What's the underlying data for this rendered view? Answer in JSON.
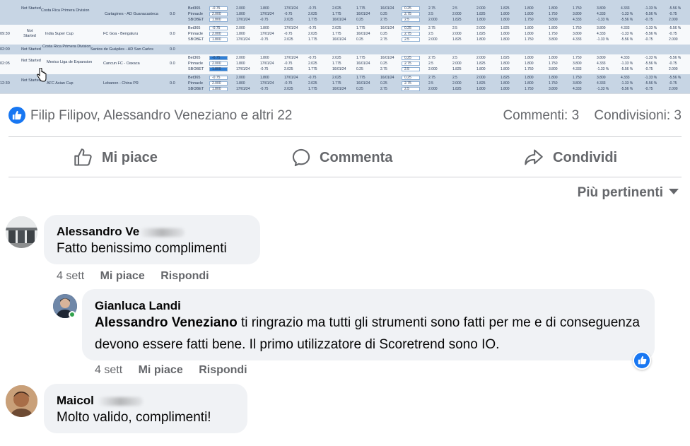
{
  "sheet": {
    "rows": [
      {
        "time": "",
        "status": "Not Started",
        "league": "Costa Rica Primera Division",
        "match": "Cartagines - AD Guanacasteca",
        "score": "0.0",
        "books": [
          "Bet365",
          "Pinnacle",
          "SBOBET"
        ]
      },
      {
        "time": "09:30",
        "status": "Not Started",
        "league": "India Super Cup",
        "match": "FC Goa - Bengaluru",
        "score": "0.0",
        "books": [
          "Bet365",
          "Pinnacle",
          "SBOBET"
        ]
      },
      {
        "time": "02:00",
        "status": "Not Started",
        "league": "Costa Rica Primera Division",
        "match": "Santos de Guápiles - AD San Carlos",
        "score": "0.0",
        "books": []
      },
      {
        "time": "02:05",
        "status": "Not Started",
        "league": "Mexico Liga de Expansion",
        "match": "Cancun FC - Oaxaca",
        "score": "0.0",
        "books": [
          "Bet365",
          "Pinnacle",
          "SBOBET"
        ]
      },
      {
        "time": "12:30",
        "status": "Not Started",
        "league": "AFC Asian Cup",
        "match": "Lebanon - China PR",
        "score": "0.0",
        "books": [
          "Bet365",
          "Pinnacle",
          "SBOBET"
        ]
      }
    ],
    "cells": [
      "-0.75",
      "2.000",
      "1.800",
      "17/01/24",
      "-0.75",
      "2.025",
      "1.775",
      "16/01/24",
      "0.25",
      "2.75",
      "2.5",
      "2.000",
      "1.825",
      "1.800",
      "1.800",
      "1.750",
      "3.800",
      "4.333",
      "-1.33 %",
      "-5.56 %"
    ]
  },
  "reactions": {
    "names": "Filip Filipov, Alessandro Veneziano e altri 22",
    "comments": "Commenti: 3",
    "shares": "Condivisioni: 3"
  },
  "actions": {
    "like": "Mi piace",
    "comment": "Commenta",
    "share": "Condividi"
  },
  "sort": {
    "label": "Più pertinenti"
  },
  "comments": [
    {
      "author": "Alessandro Ve",
      "text": "Fatto benissimo complimenti",
      "time": "4 sett",
      "like": "Mi piace",
      "reply": "Rispondi"
    },
    {
      "author": "Gianluca Landi",
      "mention": "Alessandro Veneziano",
      "text": " ti ringrazio ma tutti gli strumenti sono fatti per me e di conseguenza devono essere fatti bene. Il primo utilizzatore di Scoretrend sono IO.",
      "time": "4 sett",
      "like": "Mi piace",
      "reply": "Rispondi"
    },
    {
      "author": "Maicol",
      "text": "Molto valido, complimenti!"
    }
  ],
  "colors": {
    "brand": "#1877f2",
    "bubble": "#f0f2f5",
    "muted": "#65676b",
    "online": "#31a24c"
  }
}
